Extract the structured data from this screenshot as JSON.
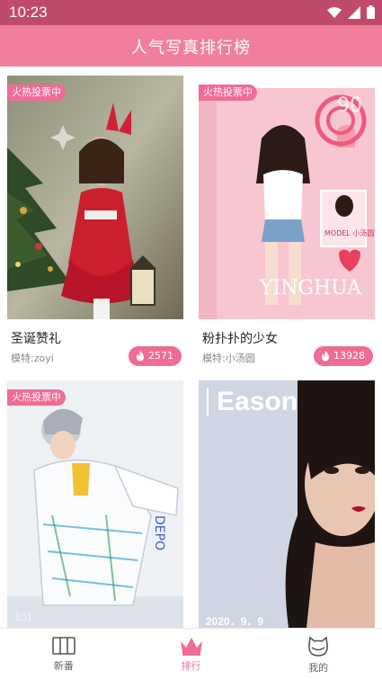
{
  "status_bar": {
    "time": "10:23"
  },
  "header": {
    "title": "人气写真排行榜"
  },
  "cards": [
    {
      "badge": "火热投票中",
      "title": "圣诞赞礼",
      "model": "模特:zoyi",
      "votes": "2571"
    },
    {
      "badge": "火热投票中",
      "title": "粉扑扑的少女",
      "model": "模特:小汤圆",
      "votes": "13928",
      "overlay_text": "YINGHUA",
      "overlay_tag": "MODEL\n小汤圆",
      "overlay_number": "90"
    },
    {
      "badge": "火热投票中",
      "title": "",
      "model": "",
      "votes": ""
    },
    {
      "badge": "",
      "title": "",
      "model": "",
      "votes": "",
      "overlay_text": "Eason",
      "overlay_date": "2020．9．9"
    }
  ],
  "bottom_nav": [
    {
      "label": "新番",
      "icon": "book-icon"
    },
    {
      "label": "排行",
      "icon": "crown-icon",
      "active": true
    },
    {
      "label": "我的",
      "icon": "cat-face-icon"
    }
  ],
  "colors": {
    "header": "#f17f9c",
    "status_bar": "#c04a6a",
    "accent": "#ef6d92"
  }
}
